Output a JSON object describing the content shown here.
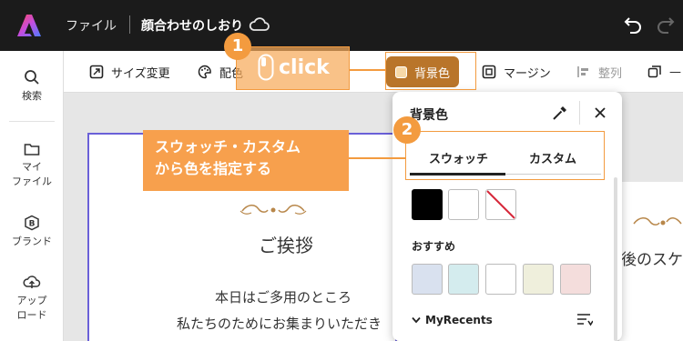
{
  "header": {
    "file_menu": "ファイル",
    "doc_title": "顔合わせのしおり"
  },
  "rail": {
    "items": [
      {
        "label": "検索"
      },
      {
        "label": "マイ\nファイル"
      },
      {
        "label": "ブランド"
      },
      {
        "label": "アップ\nロード"
      }
    ]
  },
  "toolbar": {
    "resize": "サイズ変更",
    "color": "配色",
    "background": "背景色",
    "margin": "マージン",
    "align": "整列",
    "more": "—"
  },
  "panel": {
    "title": "背景色",
    "tabs": [
      "スウォッチ",
      "カスタム"
    ],
    "recommended_label": "おすすめ",
    "my_recents": "MyRecents",
    "swatches_top": [
      "#000000",
      "#ffffff",
      "none"
    ],
    "swatches_recommended": [
      "#d9e1ef",
      "#d4ecee",
      "#ffffff",
      "#efefdc",
      "#f4dddc"
    ]
  },
  "document": {
    "heading": "ご挨拶",
    "line1": "本日はご多用のところ",
    "line2": "私たちのためにお集まりいただき",
    "right_text": "後のスケ"
  },
  "annotations": {
    "step1_number": "1",
    "step1_text": "click",
    "step2_number": "2",
    "step2_line1": "スウォッチ・カスタム",
    "step2_line2": "から色を指定する"
  },
  "colors": {
    "accent": "#f39b3f",
    "active_tool": "#b9752a",
    "selection": "#6a60d8"
  }
}
